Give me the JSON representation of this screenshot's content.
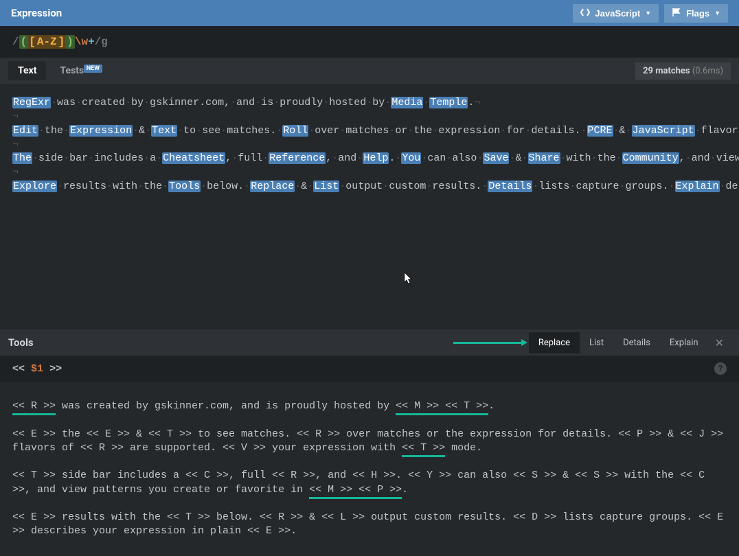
{
  "header": {
    "title": "Expression",
    "lang_button": "JavaScript",
    "flags_button": "Flags"
  },
  "expression": {
    "slash_open": "/",
    "paren_open": "(",
    "bracket_open": "[",
    "range": "A-Z",
    "bracket_close": "]",
    "paren_close": ")",
    "escape": "\\w",
    "plus": "+",
    "slash_close": "/",
    "flags": "g"
  },
  "tabs": {
    "text": "Text",
    "tests": "Tests",
    "new_badge": "NEW"
  },
  "matches": {
    "count": "29 matches",
    "time": "(0.6ms)"
  },
  "tools": {
    "title": "Tools",
    "replace": "Replace",
    "list": "List",
    "details": "Details",
    "explain": "Explain"
  },
  "replace_input": {
    "lt": "<<",
    "group_ref": "$1",
    "gt": ">>"
  }
}
